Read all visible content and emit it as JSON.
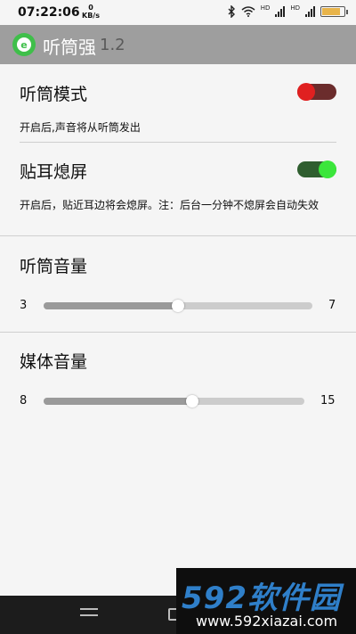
{
  "status": {
    "time": "07:22:06",
    "netspeed_value": "0",
    "netspeed_unit": "KB/s",
    "bluetooth_icon": "bluetooth-icon",
    "wifi_icon": "wifi-icon",
    "hd1": "HD",
    "hd2": "HD",
    "battery_level": 0.85,
    "battery_color": "#e8b44a"
  },
  "appbar": {
    "title": "听筒强",
    "version": "1.2",
    "icon": "ear-icon",
    "background": "#9e9e9e"
  },
  "settings": [
    {
      "title": "听筒模式",
      "desc": "开启后,声音将从听筒发出",
      "toggle_on": false,
      "color": "#e02020"
    },
    {
      "title": "贴耳熄屏",
      "desc": "开启后，贴近耳边将会熄屏。注：后台一分钟不熄屏会自动失效",
      "toggle_on": true,
      "color": "#3be63b"
    }
  ],
  "sliders": [
    {
      "title": "听筒音量",
      "min": "3",
      "max": "7",
      "value": 5
    },
    {
      "title": "媒体音量",
      "min": "8",
      "max": "15",
      "value": 12
    }
  ],
  "watermark": {
    "big": "592软件园",
    "small": "www.592xiazai.com"
  },
  "nav": {
    "back_icon": "back-icon",
    "home_icon": "home-icon"
  }
}
